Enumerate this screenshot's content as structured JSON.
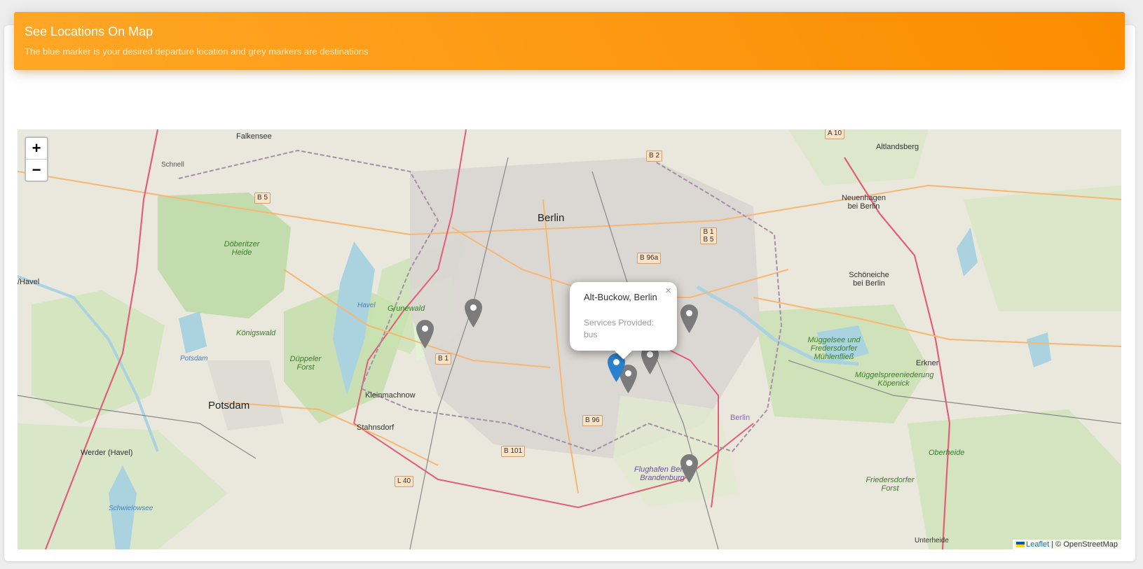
{
  "header": {
    "title": "See Locations On Map",
    "subtitle": "The blue marker is your desired departure location and grey markers are destinations"
  },
  "map": {
    "zoom_in": "+",
    "zoom_out": "−",
    "attribution_leaflet": "Leaflet",
    "attribution_sep": " | © OpenStreetMap",
    "labels": {
      "berlin": "Berlin",
      "potsdam": "Potsdam",
      "falkensee": "Falkensee",
      "altlandsberg": "Altlandsberg",
      "neuenhagen": "Neuenhagen bei Berlin",
      "schoeneiche": "Schöneiche bei Berlin",
      "erkner": "Erkner",
      "kleinmachnow": "Kleinmachnow",
      "stahnsdorf": "Stahnsdorf",
      "werder": "Werder (Havel)",
      "havel": "/Havel",
      "doeberitzer": "Döberitzer Heide",
      "grunewald": "Grunewald",
      "koenigswald": "Königswald",
      "dueppeler": "Düppeler Forst",
      "muggelsee": "Müggelsee und Fredersdorfer Mühlenfließ",
      "muggelspree": "Müggelspreeniederung Köpenick",
      "flughafen": "Flughafen Berlin Brandenburg",
      "oberheide": "Oberheide",
      "friedersdorfer": "Friedersdorfer Forst",
      "schwielowsee": "Schwielowsee",
      "potsdam_small": "Potsdam",
      "havel_water": "Havel",
      "schnell": "Schnell",
      "berlin_small": "Berlin",
      "unterheide": "Unterheide"
    },
    "shields": {
      "b5": "B 5",
      "b2": "B 2",
      "a10": "A 10",
      "b1b5": "B 1 B 5",
      "b96a": "B 96a",
      "b1": "B 1",
      "b96": "B 96",
      "b101": "B 101",
      "l40": "L 40"
    },
    "markers": {
      "departure_color": "#2a81cb",
      "destination_color": "#7b7b7b"
    },
    "popup": {
      "title": "Alt-Buckow, Berlin",
      "services": "Services Provided: bus"
    }
  }
}
